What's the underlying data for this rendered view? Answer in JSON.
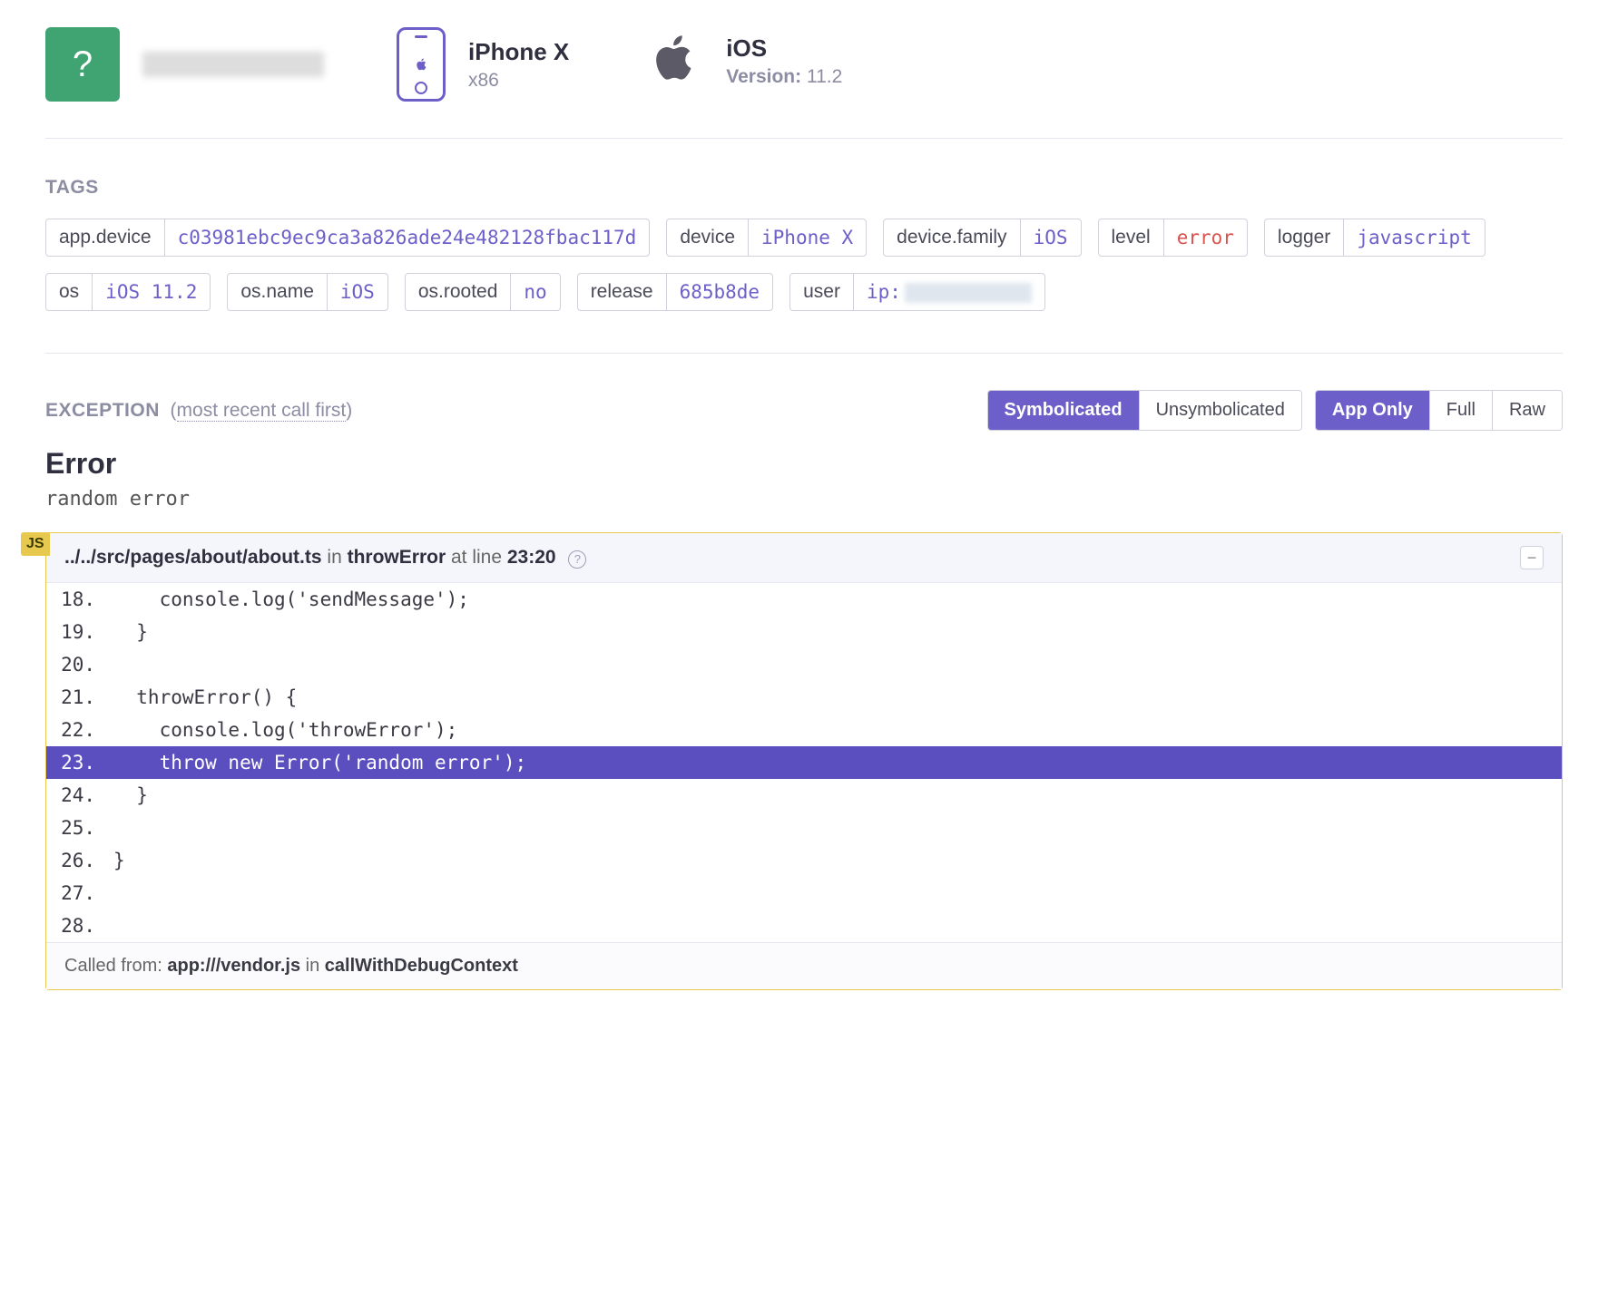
{
  "header": {
    "unknown_label": "?",
    "device": {
      "name": "iPhone X",
      "arch": "x86"
    },
    "os": {
      "name": "iOS",
      "version_label": "Version:",
      "version": "11.2"
    }
  },
  "tags": {
    "heading": "TAGS",
    "items": [
      {
        "key": "app.device",
        "value": "c03981ebc9ec9ca3a826ade24e482128fbac117d"
      },
      {
        "key": "device",
        "value": "iPhone X"
      },
      {
        "key": "device.family",
        "value": "iOS"
      },
      {
        "key": "level",
        "value": "error",
        "style": "red"
      },
      {
        "key": "logger",
        "value": "javascript"
      },
      {
        "key": "os",
        "value": "iOS 11.2"
      },
      {
        "key": "os.name",
        "value": "iOS"
      },
      {
        "key": "os.rooted",
        "value": "no"
      },
      {
        "key": "release",
        "value": "685b8de"
      },
      {
        "key": "user",
        "value": "ip:",
        "redacted_suffix": true
      }
    ]
  },
  "exception": {
    "heading": "EXCEPTION",
    "order_note": "most recent call first",
    "symb_tabs": [
      "Symbolicated",
      "Unsymbolicated"
    ],
    "symb_active": 0,
    "scope_tabs": [
      "App Only",
      "Full",
      "Raw"
    ],
    "scope_active": 0,
    "type": "Error",
    "message": "random error"
  },
  "frame": {
    "lang": "JS",
    "file": "../../src/pages/about/about.ts",
    "in": "in",
    "func": "throwError",
    "at": "at line",
    "line": "23:20",
    "collapse": "−",
    "code": [
      {
        "no": "18.",
        "text": "    console.log('sendMessage');"
      },
      {
        "no": "19.",
        "text": "  }"
      },
      {
        "no": "20.",
        "text": ""
      },
      {
        "no": "21.",
        "text": "  throwError() {"
      },
      {
        "no": "22.",
        "text": "    console.log('throwError');"
      },
      {
        "no": "23.",
        "text": "    throw new Error('random error');",
        "hl": true
      },
      {
        "no": "24.",
        "text": "  }"
      },
      {
        "no": "25.",
        "text": ""
      },
      {
        "no": "26.",
        "text": "}"
      },
      {
        "no": "27.",
        "text": ""
      },
      {
        "no": "28.",
        "text": ""
      }
    ],
    "called_from": {
      "label": "Called from:",
      "file": "app:///vendor.js",
      "in": "in",
      "func": "callWithDebugContext"
    }
  }
}
